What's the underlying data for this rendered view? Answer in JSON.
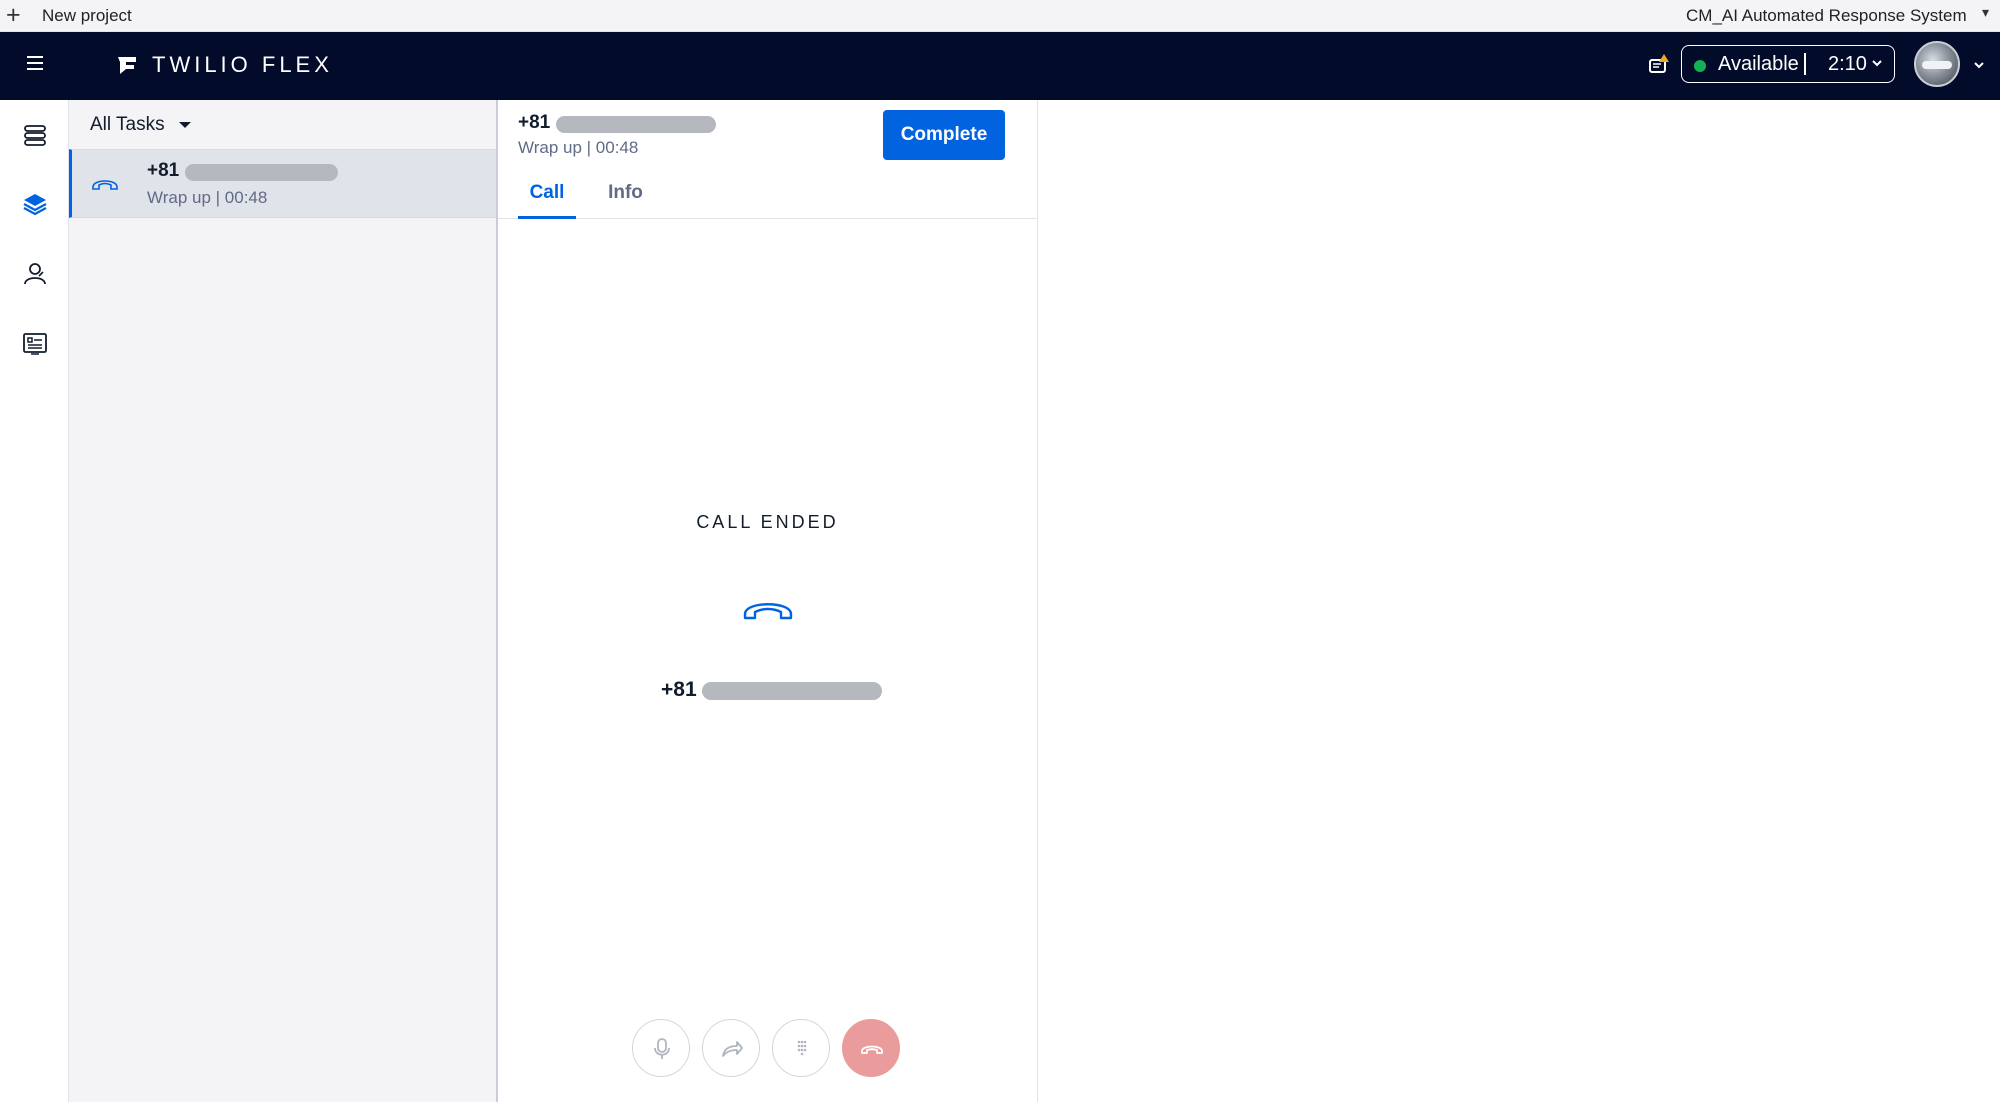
{
  "project_bar": {
    "new_project_label": "New project",
    "project_name": "CM_AI Automated Response System"
  },
  "header": {
    "brand": "TWILIO FLEX",
    "status": {
      "label": "Available",
      "timer": "2:10",
      "color": "#14b053"
    },
    "background_color": "#030b2a"
  },
  "left_nav": {
    "items": [
      {
        "name": "agent-desktop",
        "icon": "stack-list-icon"
      },
      {
        "name": "tasks",
        "icon": "layers-icon",
        "active": true
      },
      {
        "name": "teams",
        "icon": "users-icon"
      },
      {
        "name": "queues",
        "icon": "queue-stats-icon"
      }
    ]
  },
  "task_list": {
    "filter_label": "All Tasks",
    "items": [
      {
        "number_prefix": "+81",
        "status": "Wrap up | 00:48",
        "selected": true
      }
    ]
  },
  "task_detail": {
    "number_prefix": "+81",
    "status": "Wrap up | 00:48",
    "complete_label": "Complete",
    "tabs": [
      {
        "label": "Call",
        "active": true
      },
      {
        "label": "Info",
        "active": false
      }
    ],
    "call_state": "CALL ENDED",
    "caller_number_prefix": "+81",
    "controls": [
      "microphone-icon",
      "transfer-icon",
      "dialpad-icon",
      "hangup-icon"
    ],
    "accent_color": "#0263e0"
  }
}
